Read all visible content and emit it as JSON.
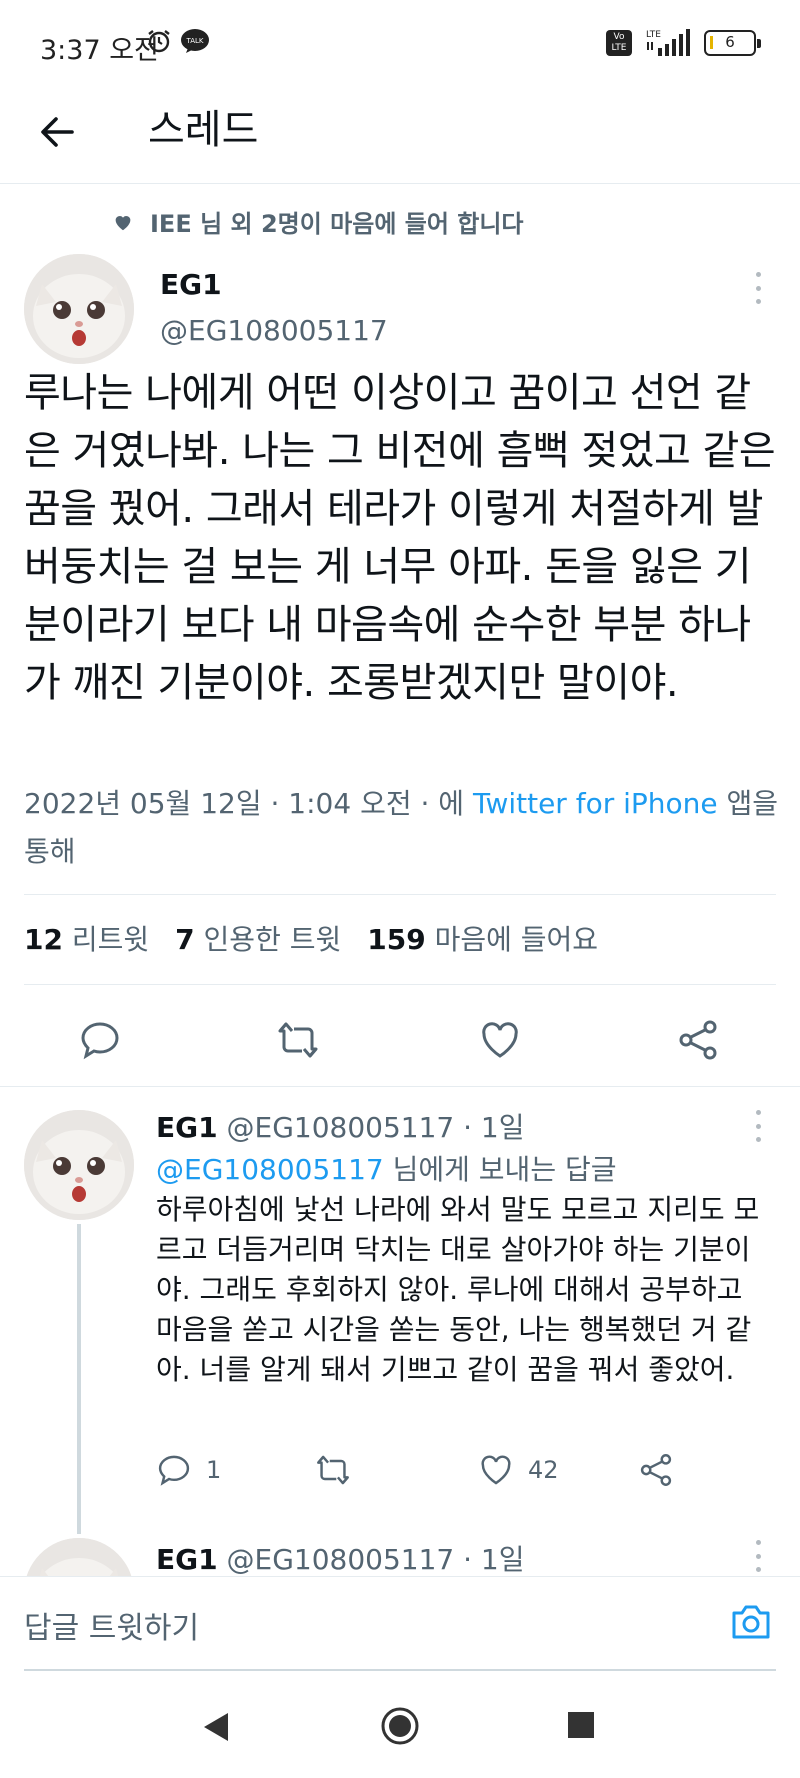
{
  "status_bar": {
    "time": "3:37 오전",
    "talk_badge": "TALK",
    "volte": "Vo LTE",
    "lte": "LTE",
    "battery": "6"
  },
  "header": {
    "title": "스레드"
  },
  "main_tweet": {
    "liked_by": "IEE 님 외 2명이 마음에 들어 합니다",
    "author_name": "EG1",
    "author_handle": "@EG108005117",
    "text": "루나는 나에게 어떤 이상이고 꿈이고 선언 같은 거였나봐. 나는 그 비전에 흠뻑 젖었고 같은 꿈을 꿨어. 그래서 테라가 이렇게 처절하게 발버둥치는 걸 보는 게 너무 아파. 돈을 잃은 기분이라기 보다 내 마음속에 순수한 부분 하나가 깨진 기분이야. 조롱받겠지만 말이야.",
    "date": "2022년 05월 12일 · 1:04 오전 · 에 ",
    "via_app": "Twitter for iPhone",
    "via_suffix": " 앱을 통해",
    "retweets_count": "12",
    "retweets_label": "리트윗",
    "quotes_count": "7",
    "quotes_label": "인용한 트윗",
    "likes_count": "159",
    "likes_label": "마음에 들어요"
  },
  "reply": {
    "author_name": "EG1",
    "author_handle": "@EG108005117",
    "age": "· 1일",
    "replying_to_handle": "@EG108005117",
    "replying_to_suffix": " 님에게 보내는 답글",
    "text": "하루아침에 낯선 나라에 와서 말도 모르고 지리도 모르고 더듬거리며 닥치는 대로 살아가야 하는 기분이야. 그래도 후회하지 않아. 루나에 대해서 공부하고 마음을 쏟고 시간을 쏟는 동안, 나는 행복했던 거 같아. 너를 알게 돼서 기쁘고 같이 꿈을 꿔서 좋았어.",
    "reply_count": "1",
    "like_count": "42"
  },
  "next_reply": {
    "author_name": "EG1",
    "author_handle": "@EG108005117",
    "age": "· 1일"
  },
  "composer": {
    "placeholder": "답글 트윗하기"
  },
  "colors": {
    "accent": "#1d9bf0",
    "muted": "#536471",
    "text": "#0f1419"
  }
}
